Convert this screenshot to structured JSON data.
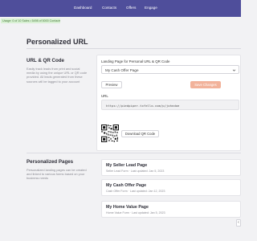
{
  "nav": {
    "items": [
      {
        "label": "Dashboard"
      },
      {
        "label": "Contacts"
      },
      {
        "label": "Offers"
      },
      {
        "label": "Engage"
      }
    ]
  },
  "usage_badge": "Usage: 0 of 10 Sales • 5498 of 5000 Contacts",
  "page_title": "Personalized URL",
  "url_section": {
    "title": "URL & QR Code",
    "description": "Easily track leads from print and social media by using the unique URL or QR code provided. All leads generated from these sources will be tagged to your account",
    "landing_label": "Landing Page for Personal URL & QR Code",
    "selected_page": "My Cash Offer Page",
    "preview_label": "Preview",
    "save_label": "Save Changes",
    "url_label": "URL",
    "url_value": "https://piedpiper.txfello.com/p/johndoe",
    "download_label": "Download QR Code"
  },
  "pages_section": {
    "title": "Personalized Pages",
    "description": "Personalized landing pages can be created and linked to various forms based on your business needs",
    "pages": [
      {
        "name": "My Seller Lead Page",
        "meta": "Seller Lead Form · Last updated: Jan 5, 2023"
      },
      {
        "name": "My Cash Offer Page",
        "meta": "Cash Offer Form · Last updated: Jan 12, 2023"
      },
      {
        "name": "My Home Value Page",
        "meta": "Home Value Form · Last updated: Jan 5, 2023"
      }
    ]
  },
  "colors": {
    "topbar": "#4f4e9b",
    "save_button": "#f2b29a",
    "usage_badge_bg": "#d8f0d3"
  },
  "icons": [
    "chevron-down-icon",
    "qr-code-icon"
  ]
}
